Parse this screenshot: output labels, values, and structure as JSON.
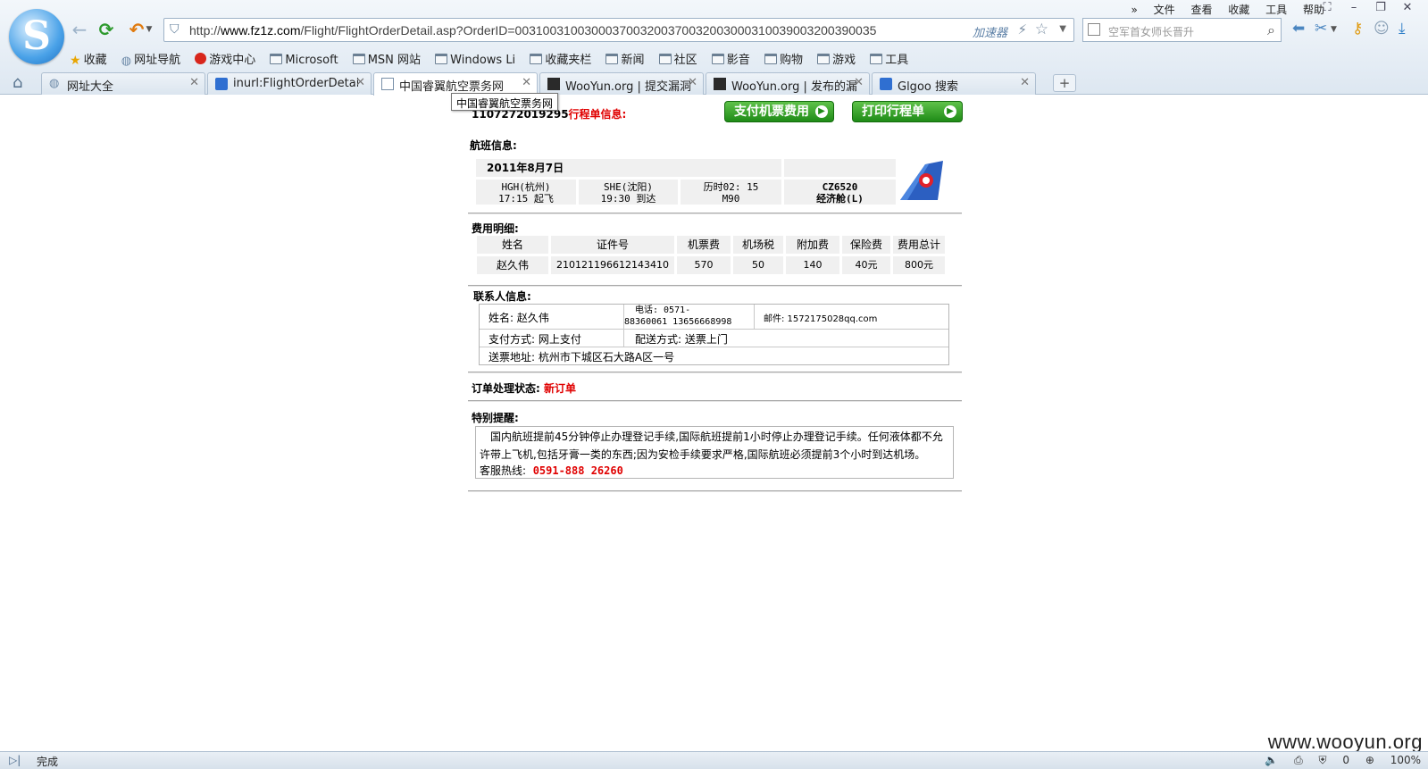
{
  "browser": {
    "url_prefix": "http://",
    "url_domain": "www.fz1z.com",
    "url_path": "/Flight/FlightOrderDetail.asp?OrderID=0031003100300037003200370032003000310039003200390035",
    "accelerator": "加速器",
    "search_placeholder": "空军首女师长晋升",
    "menus": [
      "文件",
      "查看",
      "收藏",
      "工具",
      "帮助"
    ],
    "bookmarks": [
      {
        "label": "收藏",
        "icon": "star-icon"
      },
      {
        "label": "网址导航",
        "icon": "globe-icon"
      },
      {
        "label": "游戏中心",
        "icon": "game-icon"
      },
      {
        "label": "Microsoft",
        "icon": "folder-icon"
      },
      {
        "label": "MSN 网站",
        "icon": "folder-icon"
      },
      {
        "label": "Windows Li",
        "icon": "folder-icon"
      },
      {
        "label": "收藏夹栏",
        "icon": "folder-icon"
      },
      {
        "label": "新闻",
        "icon": "folder-icon"
      },
      {
        "label": "社区",
        "icon": "folder-icon"
      },
      {
        "label": "影音",
        "icon": "folder-icon"
      },
      {
        "label": "购物",
        "icon": "folder-icon"
      },
      {
        "label": "游戏",
        "icon": "folder-icon"
      },
      {
        "label": "工具",
        "icon": "folder-icon"
      }
    ],
    "tabs": [
      {
        "label": "网址大全",
        "icon": "globe-icon",
        "active": false
      },
      {
        "label": "inurl:FlightOrderDetail.",
        "icon": "search-icon",
        "active": false
      },
      {
        "label": "中国睿翼航空票务网",
        "icon": "page-icon",
        "active": true
      },
      {
        "label": "WooYun.org | 提交漏洞",
        "icon": "wooyun-icon",
        "active": false
      },
      {
        "label": "WooYun.org | 发布的漏",
        "icon": "wooyun-icon",
        "active": false
      },
      {
        "label": "Glgoo 搜索",
        "icon": "search-icon",
        "active": false
      }
    ],
    "tooltip": "中国睿翼航空票务网",
    "status_text": "完成",
    "status_count": "0",
    "zoom": "100%",
    "watermark": "www.wooyun.org"
  },
  "order": {
    "number": "1107272019295",
    "title_suffix": "行程单信息:",
    "pay_button": "支付机票费用",
    "print_button": "打印行程单",
    "flight_section": "航班信息:",
    "flight": {
      "date": "2011年8月7日",
      "from": "HGH(杭州)",
      "depart": "17:15 起飞",
      "to": "SHE(沈阳)",
      "arrive": "19:30 到达",
      "duration": "历时02: 15",
      "aircraft": "M90",
      "flight_no": "CZ6520",
      "cabin": "经济舱(L)"
    },
    "fee_section": "费用明细:",
    "fee_headers": [
      "姓名",
      "证件号",
      "机票费",
      "机场税",
      "附加费",
      "保险费",
      "费用总计"
    ],
    "fee_row": [
      "赵久伟",
      "210121196612143410",
      "570",
      "50",
      "140",
      "40元",
      "800元"
    ],
    "contact_section": "联系人信息:",
    "contact": {
      "name": "姓名: 赵久伟",
      "phone_line1": "电话: 0571-",
      "phone_line2": "88360061 13656668998",
      "email": "邮件: 1572175028qq.com",
      "pay_method": "支付方式: 网上支付",
      "delivery": "配送方式: 送票上门",
      "address": "送票地址: 杭州市下城区石大路A区一号"
    },
    "status_label": "订单处理状态:",
    "status_value": "新订单",
    "remind_section": "特别提醒:",
    "remind_text": "国内航班提前45分钟停止办理登记手续,国际航班提前1小时停止办理登记手续。任何液体都不允许带上飞机,包括牙膏一类的东西;因为安检手续要求严格,国际航班必须提前3个小时到达机场。",
    "hotline_label": "客服热线:",
    "hotline": "0591-888 26260"
  }
}
